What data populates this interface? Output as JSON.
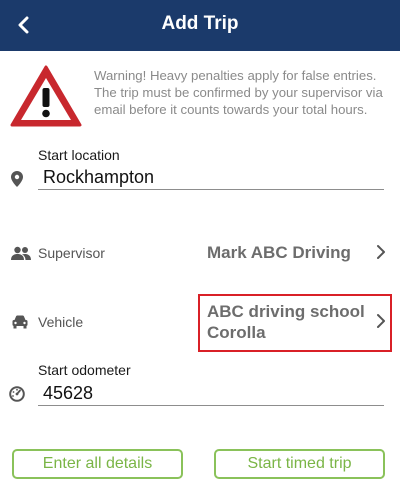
{
  "appbar": {
    "title": "Add Trip",
    "back_icon": "chevron-left-icon",
    "background_color": "#1b3a6b"
  },
  "warning": {
    "icon": "warning-triangle-icon",
    "text": "Warning! Heavy penalties apply for false entries. The trip must be confirmed by your supervisor via email before it counts towards your total hours."
  },
  "start_location": {
    "label": "Start location",
    "value": "Rockhampton",
    "icon": "location-pin-icon"
  },
  "supervisor": {
    "label": "Supervisor",
    "value": "Mark ABC Driving",
    "icon": "people-icon"
  },
  "vehicle": {
    "label": "Vehicle",
    "value_line1": "ABC driving school",
    "value_line2": "Corolla",
    "icon": "car-icon",
    "highlight_color": "#d92027"
  },
  "start_odometer": {
    "label": "Start odometer",
    "value": "45628",
    "icon": "speedometer-icon"
  },
  "buttons": {
    "enter_all_details": "Enter all details",
    "start_timed_trip": "Start timed trip",
    "color": "#7ab546"
  }
}
